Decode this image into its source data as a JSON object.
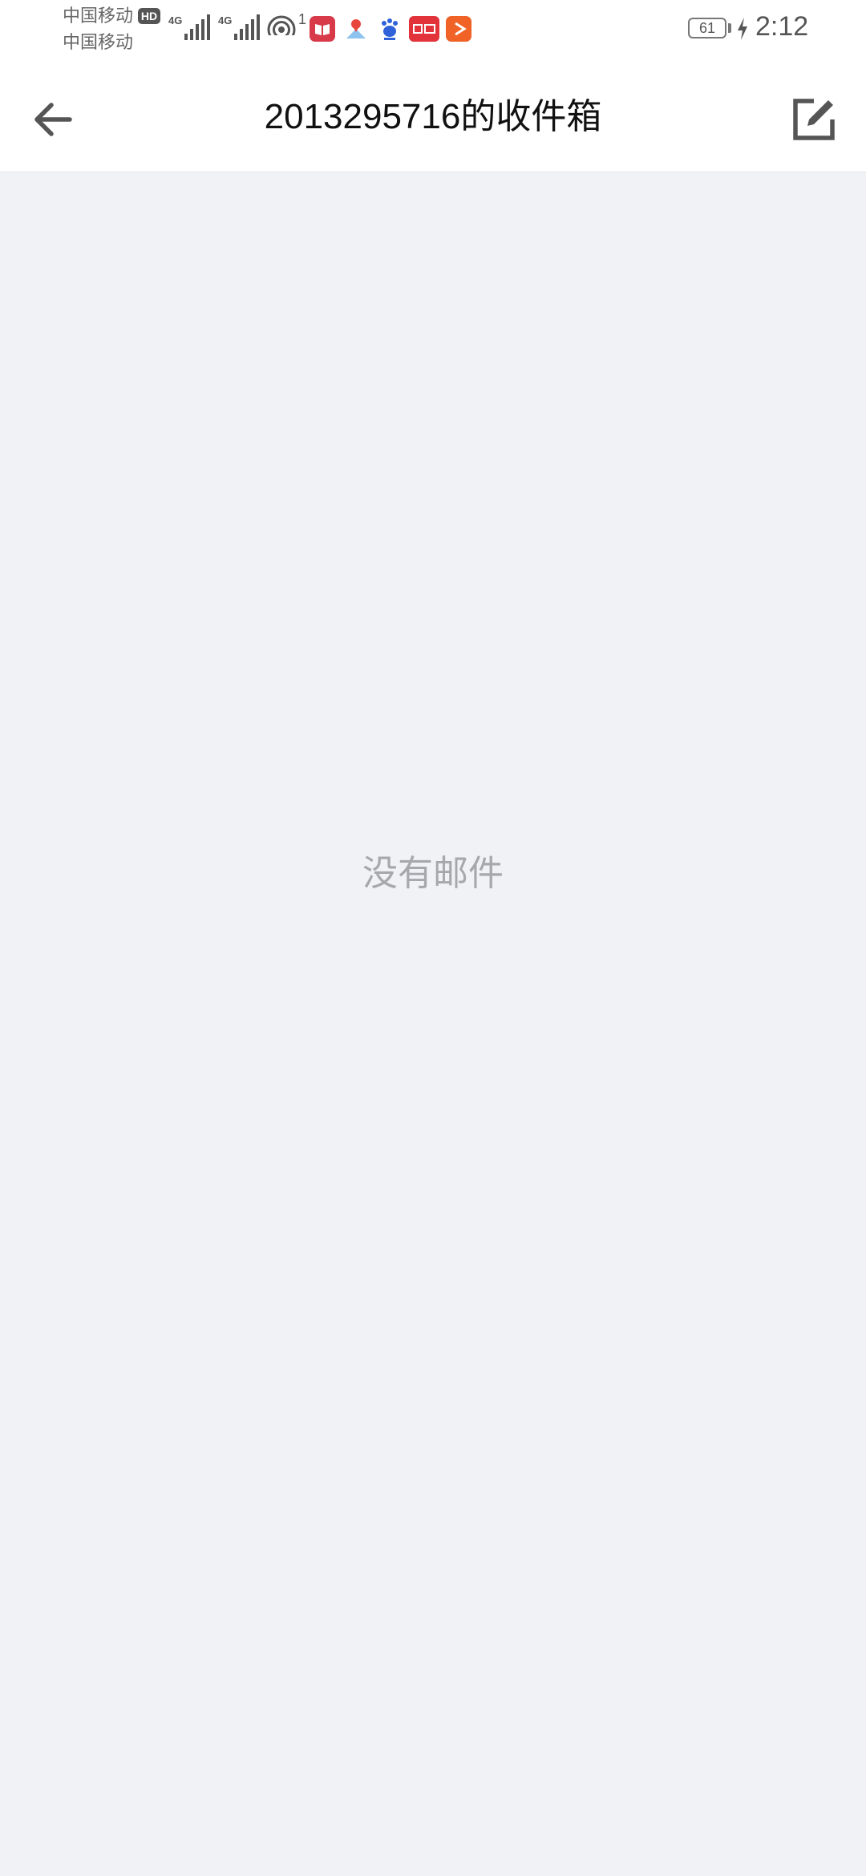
{
  "status_bar": {
    "carrier_1": "中国移动",
    "carrier_2": "中国移动",
    "hd_badge": "HD",
    "network_1": "4G",
    "network_2": "4G",
    "hotspot_count": "1",
    "battery_level": "61",
    "time": "2:12",
    "notification_icons": [
      "book-reader-icon",
      "map-pin-icon",
      "baidu-paw-icon",
      "toutiao-icon",
      "video-play-icon"
    ]
  },
  "header": {
    "title": "2013295716的收件箱",
    "back_icon": "arrow-left-icon",
    "compose_icon": "edit-square-icon"
  },
  "content": {
    "empty_message": "没有邮件"
  },
  "colors": {
    "background": "#f1f2f6",
    "header_bg": "#ffffff",
    "icon_gray": "#555555",
    "empty_text": "#a6a8ad"
  }
}
